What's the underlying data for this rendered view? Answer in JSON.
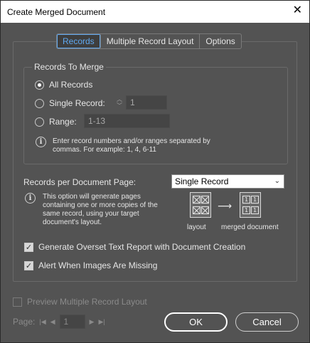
{
  "window": {
    "title": "Create Merged Document",
    "close_glyph": "✕"
  },
  "tabs": [
    {
      "label": "Records",
      "active": true
    },
    {
      "label": "Multiple Record Layout",
      "active": false
    },
    {
      "label": "Options",
      "active": false
    }
  ],
  "records_to_merge": {
    "label": "Records To Merge",
    "all_records": {
      "label": "All Records",
      "checked": true
    },
    "single_record": {
      "label": "Single Record:",
      "value": "1",
      "checked": false
    },
    "range": {
      "label": "Range:",
      "value": "1-13",
      "checked": false
    },
    "hint_line1": "Enter record numbers and/or ranges separated by",
    "hint_line2": "commas. For example: 1, 4, 6-11"
  },
  "records_per_page": {
    "label": "Records per Document Page:",
    "selected": "Single Record",
    "info_line1": "This option will generate pages",
    "info_line2": "containing one or more copies of the",
    "info_line3": "same record, using your target",
    "info_line4": "document's layout.",
    "layout_caption": "layout",
    "merged_caption": "merged document",
    "arrow": "⟶",
    "cell_number": "1"
  },
  "options": {
    "overset": {
      "label": "Generate Overset Text Report with Document Creation",
      "checked": true
    },
    "images_missing": {
      "label": "Alert When Images Are Missing",
      "checked": true
    }
  },
  "preview": {
    "label": "Preview Multiple Record Layout",
    "checked": false,
    "page_label": "Page:",
    "page_value": "1",
    "first": "|◀",
    "prev": "◀",
    "next": "▶",
    "last": "▶|"
  },
  "buttons": {
    "ok": "OK",
    "cancel": "Cancel"
  },
  "info_glyph": "i",
  "check_glyph": "✓",
  "spin_up": "︿",
  "spin_down": "﹀",
  "select_chevron": "⌄"
}
